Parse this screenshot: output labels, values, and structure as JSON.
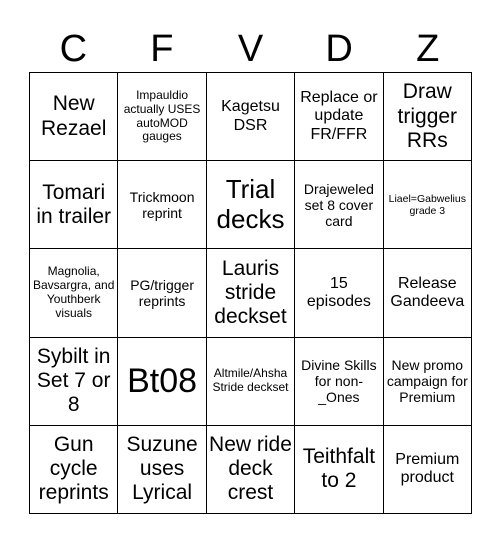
{
  "card": {
    "header": [
      "C",
      "F",
      "V",
      "D",
      "Z"
    ],
    "rows": [
      [
        {
          "text": "New Rezael",
          "size": "l"
        },
        {
          "text": "Impauldio actually USES autoMOD gauges",
          "size": "xs"
        },
        {
          "text": "Kagetsu DSR",
          "size": "m"
        },
        {
          "text": "Replace or update FR/FFR",
          "size": "m"
        },
        {
          "text": "Draw trigger RRs",
          "size": "l"
        }
      ],
      [
        {
          "text": "Tomari in trailer",
          "size": "l"
        },
        {
          "text": "Trickmoon reprint",
          "size": "s"
        },
        {
          "text": "Trial decks",
          "size": "t"
        },
        {
          "text": "Drajeweled set 8 cover card",
          "size": "s"
        },
        {
          "text": "Liael=Gabwelius grade 3",
          "size": "xxs"
        }
      ],
      [
        {
          "text": "Magnolia, Bavsargra, and Youthberk visuals",
          "size": "xs"
        },
        {
          "text": "PG/trigger reprints",
          "size": "s"
        },
        {
          "text": "Lauris stride deckset",
          "size": "l"
        },
        {
          "text": "15 episodes",
          "size": "m"
        },
        {
          "text": "Release Gandeeva",
          "size": "m"
        }
      ],
      [
        {
          "text": "Sybilt in Set 7 or 8",
          "size": "l"
        },
        {
          "text": "Bt08",
          "size": "xl"
        },
        {
          "text": "Altmile/Ahsha Stride deckset",
          "size": "xs"
        },
        {
          "text": "Divine Skills for non-_Ones",
          "size": "s"
        },
        {
          "text": "New promo campaign for Premium",
          "size": "s"
        }
      ],
      [
        {
          "text": "Gun cycle reprints",
          "size": "l"
        },
        {
          "text": "Suzune uses Lyrical",
          "size": "l"
        },
        {
          "text": "New ride deck crest",
          "size": "l"
        },
        {
          "text": "Teithfalt to 2",
          "size": "l"
        },
        {
          "text": "Premium product",
          "size": "m"
        }
      ]
    ]
  }
}
